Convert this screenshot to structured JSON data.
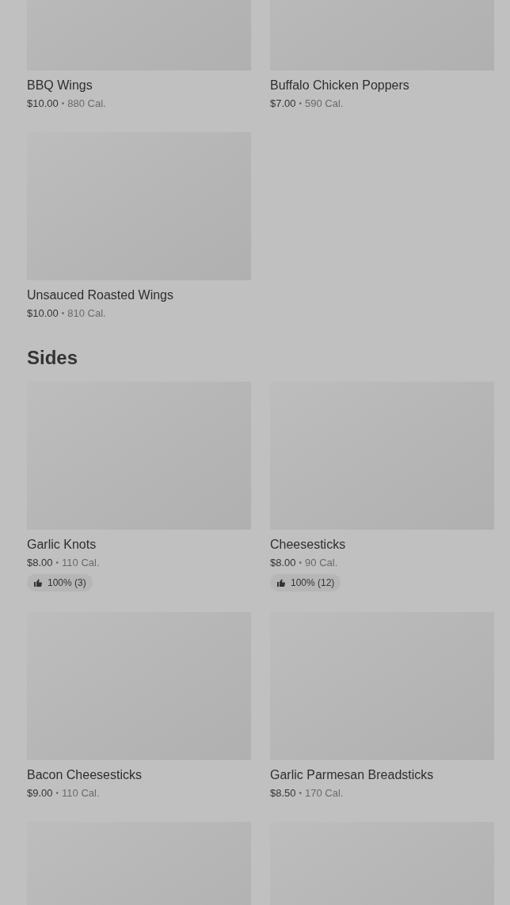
{
  "sections": [
    {
      "items": [
        {
          "kind": "dish",
          "name": "BBQ Wings",
          "price": "$10.00",
          "separator": "•",
          "calories": "880 Cal."
        },
        {
          "kind": "dish",
          "name": "Buffalo Chicken Poppers",
          "price": "$7.00",
          "separator": "•",
          "calories": "590 Cal."
        },
        {
          "kind": "dish",
          "name": "Unsauced Roasted Wings",
          "price": "$10.00",
          "separator": "•",
          "calories": "810 Cal."
        }
      ]
    },
    {
      "heading": "Sides",
      "items": [
        {
          "kind": "dish",
          "name": "Garlic Knots",
          "price": "$8.00",
          "separator": "•",
          "calories": "110 Cal.",
          "rating": "100% (3)"
        },
        {
          "kind": "dish",
          "name": "Cheesesticks",
          "price": "$8.00",
          "separator": "•",
          "calories": "90 Cal.",
          "rating": "100% (12)"
        },
        {
          "kind": "dish",
          "name": "Bacon Cheesesticks",
          "price": "$9.00",
          "separator": "•",
          "calories": "110 Cal."
        },
        {
          "kind": "dish",
          "name": "Garlic Parmesan Breadsticks",
          "price": "$8.50",
          "separator": "•",
          "calories": "170 Cal."
        },
        {
          "kind": "image-only"
        },
        {
          "kind": "image-only"
        }
      ]
    }
  ]
}
